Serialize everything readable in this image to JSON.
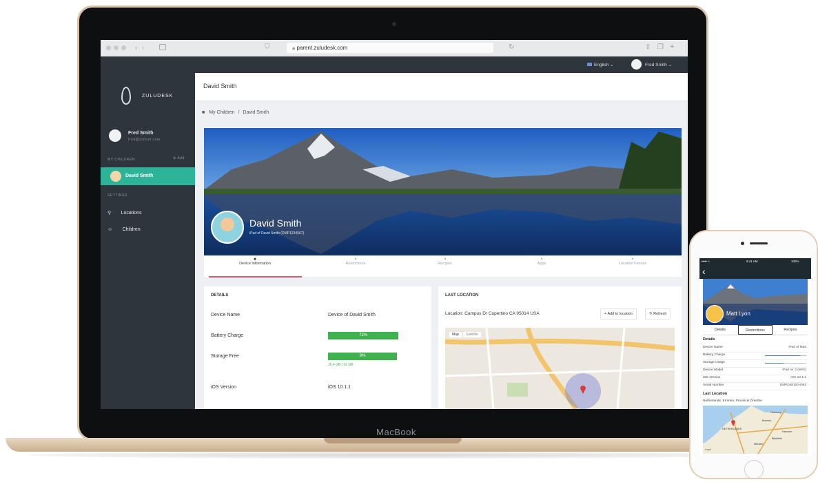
{
  "macbook": {
    "brand": "MacBook"
  },
  "browser": {
    "url": "parent.zuludesk.com"
  },
  "topbar": {
    "language": "English",
    "user": "Fred Smith"
  },
  "sidebar": {
    "logo": "ZULUDESK",
    "profile": {
      "name": "Fred Smith",
      "email": "fred@school.com"
    },
    "section_children": "MY CHILDREN",
    "add_label": "Add",
    "active_child": "David Smith",
    "section_settings": "SETTINGS",
    "items": [
      {
        "label": "Locations"
      },
      {
        "label": "Children"
      }
    ]
  },
  "main": {
    "page_title": "David Smith",
    "breadcrumb": {
      "root": "My Children",
      "current": "David Smith"
    },
    "cover": {
      "name": "David Smith",
      "subtitle": "iPad of David Smith (DMP1234567)"
    },
    "tabs": [
      {
        "label": "Device Information",
        "icon": "info-icon"
      },
      {
        "label": "Restrictions",
        "icon": "lock-icon"
      },
      {
        "label": "Recipes",
        "icon": "recipes-icon"
      },
      {
        "label": "Apps",
        "icon": "apps-icon"
      },
      {
        "label": "Location Fences",
        "icon": "pin-icon"
      }
    ],
    "details": {
      "heading": "DETAILS",
      "rows": [
        {
          "label": "Device Name",
          "value": "Device of David Smith"
        },
        {
          "label": "Battery Charge",
          "value": "72%",
          "level": 0.72
        },
        {
          "label": "Storage Free",
          "value": "9%",
          "level": 0.09,
          "note": "16.4 GB / 16 GB"
        },
        {
          "label": "iOS Version",
          "value": "iOS 10.1.1"
        }
      ]
    },
    "location": {
      "heading": "LAST LOCATION",
      "text": "Location: Campus Dr Cupertino CA 95014 USA",
      "add_button": "Add to location",
      "refresh_button": "Refresh",
      "map_tabs": [
        "Map",
        "Satellite"
      ]
    }
  },
  "iphone": {
    "status": {
      "carrier": "••••• ≈",
      "time": "9:41 AM",
      "battery": "100%"
    },
    "cover_name": "Matt Lyon",
    "tabs": [
      "Details",
      "Restrictions",
      "Recipes"
    ],
    "details_heading": "Details",
    "rows": [
      {
        "label": "Device Name",
        "value": "iPad of Matt"
      },
      {
        "label": "Battery Charge",
        "value": "",
        "level": 0.85
      },
      {
        "label": "Storage Usage",
        "value": "",
        "level": 0.45
      },
      {
        "label": "Device Model",
        "value": "iPad Air 2 (WiFi)"
      },
      {
        "label": "iOS Version",
        "value": "iOS 10.1.1"
      },
      {
        "label": "Serial Number",
        "value": "DMPDB4DDH053"
      }
    ],
    "location_heading": "Last Location",
    "location_text": "Netherlands, Emmen, Provincie Drenthe",
    "map_labels": [
      "Hamburg",
      "Bremen",
      "NETHERLANDS",
      "Hanover",
      "Bielefeld",
      "Münster"
    ],
    "map_legal": "Legal"
  },
  "colors": {
    "sidebar": "#2e353d",
    "accent_teal": "#2eb39b",
    "bar_green": "#3fb24f",
    "tab_red": "#e25b6b"
  }
}
